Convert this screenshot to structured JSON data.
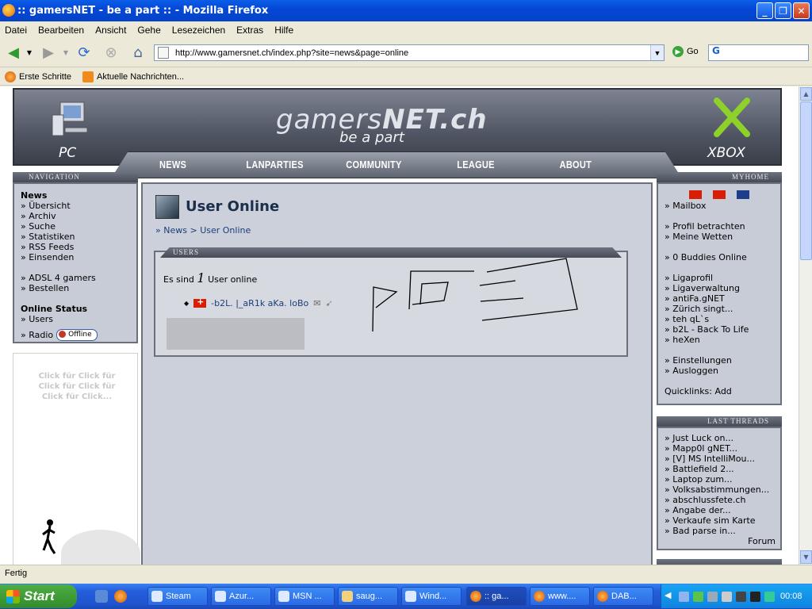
{
  "window": {
    "title": ":: gamersNET - be a part :: - Mozilla Firefox"
  },
  "menu": [
    "Datei",
    "Bearbeiten",
    "Ansicht",
    "Gehe",
    "Lesezeichen",
    "Extras",
    "Hilfe"
  ],
  "address": {
    "url": "http://www.gamersnet.ch/index.php?site=news&page=online",
    "go_label": "Go"
  },
  "bookmarks": [
    "Erste Schritte",
    "Aktuelle Nachrichten..."
  ],
  "site": {
    "logo_prefix": "gamers",
    "logo_main": "NET.ch",
    "tagline": "be a part",
    "left_label": "PC",
    "right_label": "XBOX",
    "nav": [
      "NEWS",
      "LANPARTIES",
      "COMMUNITY",
      "LEAGUE",
      "ABOUT"
    ]
  },
  "navigation": {
    "heading": "NAVIGATION",
    "section": "News",
    "items": [
      "» Übersicht",
      "» Archiv",
      "» Suche",
      "» Statistiken",
      "» RSS Feeds",
      "» Einsenden"
    ],
    "extra": [
      "» ADSL 4 gamers",
      "» Bestellen"
    ],
    "online_heading": "Online Status",
    "online_users": "» Users",
    "radio_label": "» Radio",
    "radio_status": "Offline"
  },
  "ad": {
    "text": "Click für Click für Click für Click für Click für Click..."
  },
  "page": {
    "title": "User Online",
    "breadcrumb_news": "News",
    "breadcrumb_sep": ">",
    "breadcrumb_current": "User Online",
    "breadcrumb_prefix": "»",
    "users_heading": "USERS",
    "es_sind": "Es sind",
    "count": "1",
    "user_online": "User online",
    "user_name": "-b2L. |_aR1k aKa. loBo"
  },
  "myhome": {
    "heading": "MYHOME",
    "links": [
      "» Mailbox",
      "» Profil betrachten",
      "» Meine Wetten",
      "» 0 Buddies Online",
      "» Ligaprofil",
      "» Ligaverwaltung",
      "» antiFa.gNET",
      "» Zürich singt...",
      "» teh qL`s",
      "» b2L - Back To Life",
      "» heXen",
      "» Einstellungen",
      "» Ausloggen"
    ],
    "quicklinks": "Quicklinks: Add"
  },
  "threads": {
    "heading": "LAST THREADS",
    "items": [
      "» Just Luck on...",
      "» Mapp0l gNET...",
      "» [V] MS IntelliMou...",
      "» Battlefield 2...",
      "» Laptop zum...",
      "» Volksabstimmungen...",
      "» abschlussfete.ch",
      "» Angabe der...",
      "» Verkaufe sim Karte",
      "» Bad parse in..."
    ],
    "forum": "Forum"
  },
  "statusbar": {
    "text": "Fertig"
  },
  "taskbar": {
    "start": "Start",
    "buttons": [
      "Steam",
      "Azur...",
      "MSN ...",
      "saug...",
      "Wind...",
      ":: ga...",
      "www....",
      "DAB..."
    ],
    "clock": "00:08"
  }
}
